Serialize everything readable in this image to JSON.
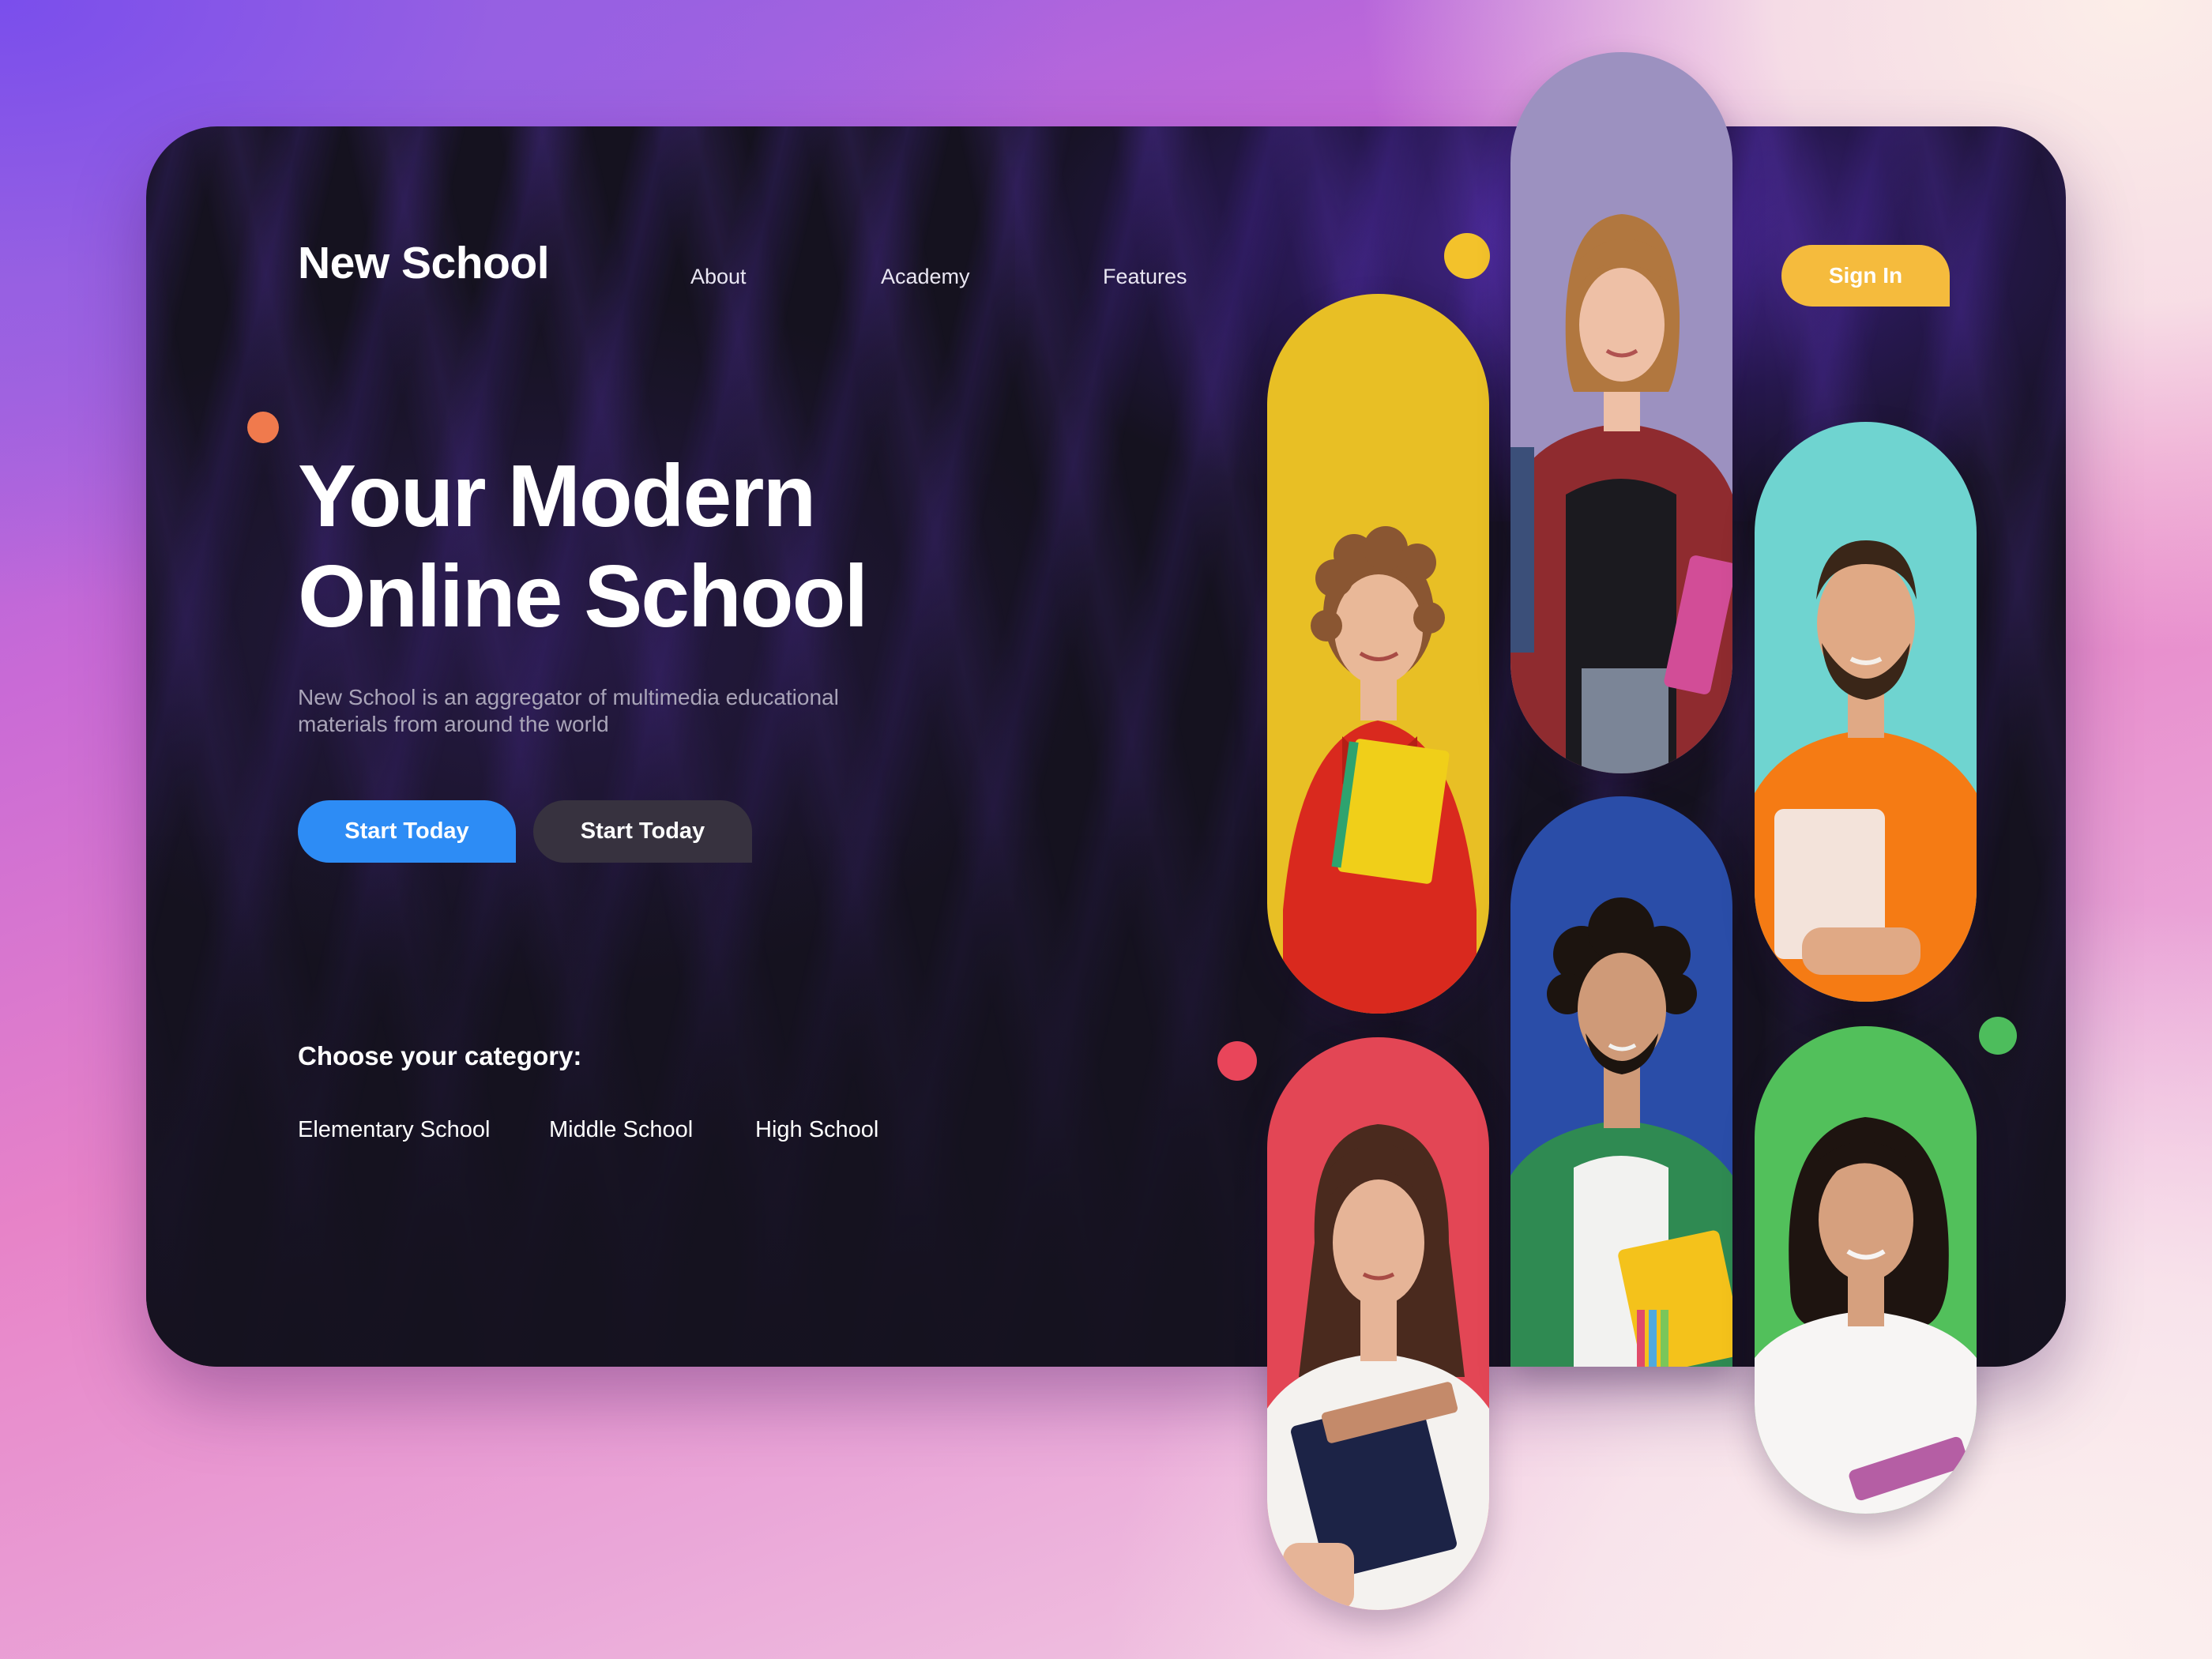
{
  "header": {
    "logo": "New School",
    "nav": [
      "About",
      "Academy",
      "Features"
    ],
    "sign_in": "Sign In"
  },
  "hero": {
    "title_line1": "Your Modern",
    "title_line2": "Online School",
    "description": "New School is an aggregator of multimedia educational materials from around the world",
    "primary_button": "Start Today",
    "secondary_button": "Start Today"
  },
  "categories": {
    "title": "Choose your category:",
    "items": [
      "Elementary School",
      "Middle School",
      "High School"
    ]
  },
  "photos": [
    {
      "name": "student-photo-1",
      "bg_color": "#e8bf25",
      "shirt_color": "#d9291e",
      "hair_color": "#8a5632",
      "skin_color": "#e9b898",
      "book_color": "#f0cf19"
    },
    {
      "name": "student-photo-2",
      "bg_color": "#9c91c0",
      "shirt_color": "#1b1a1f",
      "hair_color": "#b1773f",
      "skin_color": "#eec0a6",
      "book_color": "#d24d97"
    },
    {
      "name": "student-photo-3",
      "bg_color": "#e34655",
      "shirt_color": "#f4f2ef",
      "hair_color": "#4a2a1e",
      "skin_color": "#e6b497",
      "book_color": "#1c2346"
    },
    {
      "name": "student-photo-4",
      "bg_color": "#2a4da8",
      "shirt_color": "#2f8a52",
      "hair_color": "#1c140f",
      "skin_color": "#cf9a78",
      "book_color": "#f4c21b"
    },
    {
      "name": "student-photo-5",
      "bg_color": "#6fd4d0",
      "shirt_color": "#f57b14",
      "hair_color": "#3a2618",
      "skin_color": "#e0a985",
      "book_color": "#f3e3da"
    },
    {
      "name": "student-photo-6",
      "bg_color": "#52c05b",
      "shirt_color": "#f7f5f4",
      "hair_color": "#1e1410",
      "skin_color": "#d6a07e",
      "book_color": "#b55ea4"
    }
  ],
  "colors": {
    "card_background": "#15121f",
    "primary_button": "#2d8cf5",
    "secondary_button": "#37323f",
    "sign_in_button": "#f5bb3d",
    "dot_orange": "#f07a4d",
    "dot_yellow": "#f3c22b",
    "dot_red": "#e9455a",
    "dot_green": "#4dbd5c"
  }
}
